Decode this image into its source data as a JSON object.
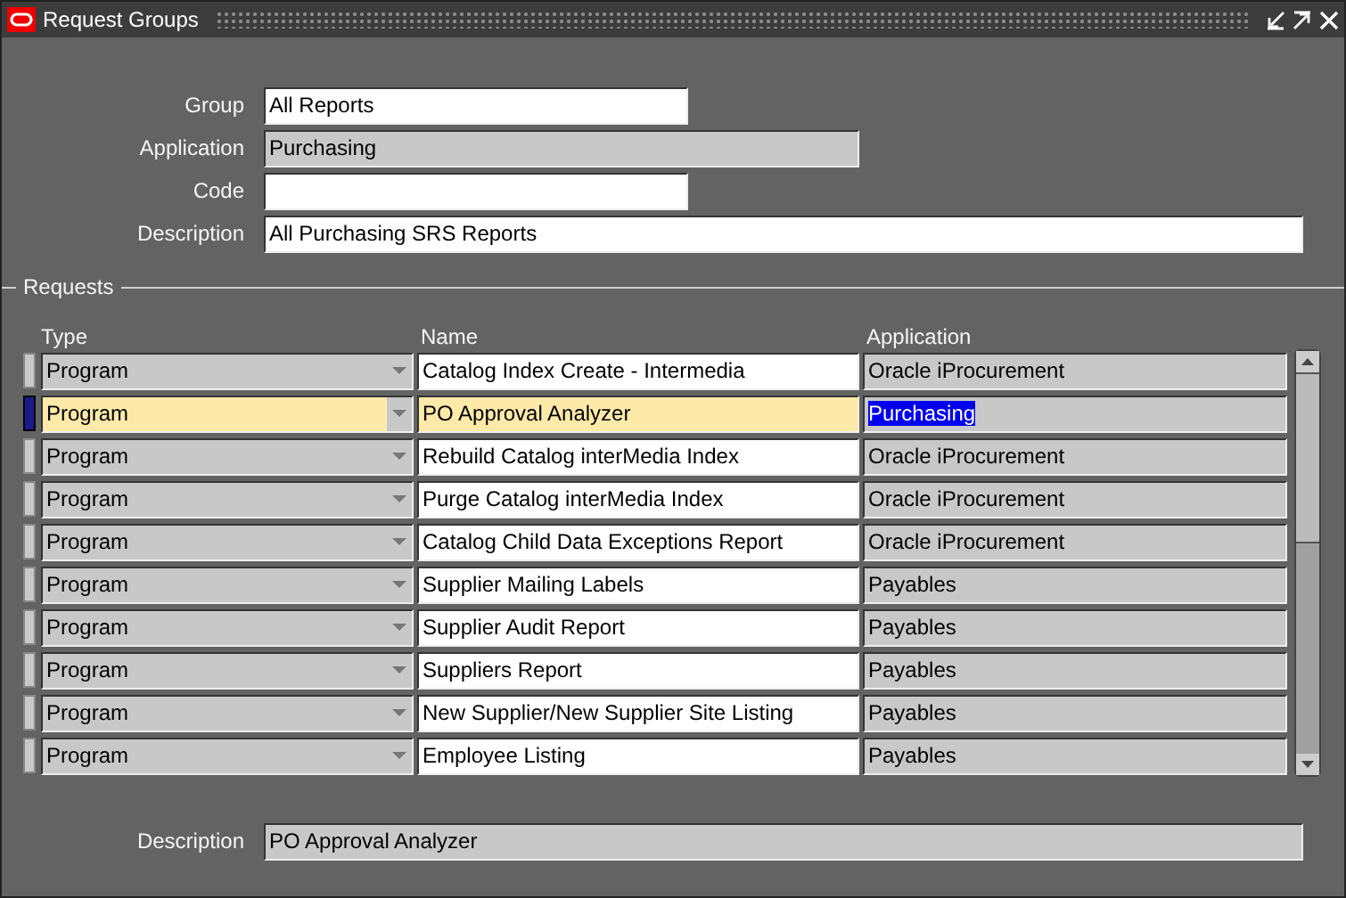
{
  "window": {
    "title": "Request Groups"
  },
  "header_fields": [
    {
      "label": "Group",
      "value": "All Reports",
      "editable": true
    },
    {
      "label": "Application",
      "value": "Purchasing",
      "editable": false
    },
    {
      "label": "Code",
      "editable": true
    },
    {
      "label": "Description",
      "value": "All Purchasing SRS Reports",
      "editable": true
    }
  ],
  "requests": {
    "title": "Requests",
    "columns": [
      "Type",
      "Name",
      "Application"
    ],
    "rows": [
      {
        "type": "Program",
        "name": "Catalog Index Create - Intermedia",
        "application": "Oracle iProcurement",
        "selected": false
      },
      {
        "type": "Program",
        "name": "PO Approval Analyzer",
        "application": "Purchasing",
        "selected": true
      },
      {
        "type": "Program",
        "name": "Rebuild Catalog interMedia Index",
        "application": "Oracle iProcurement",
        "selected": false
      },
      {
        "type": "Program",
        "name": "Purge Catalog interMedia Index",
        "application": "Oracle iProcurement",
        "selected": false
      },
      {
        "type": "Program",
        "name": "Catalog Child Data Exceptions Report",
        "application": "Oracle iProcurement",
        "selected": false
      },
      {
        "type": "Program",
        "name": "Supplier Mailing Labels",
        "application": "Payables",
        "selected": false
      },
      {
        "type": "Program",
        "name": "Supplier Audit Report",
        "application": "Payables",
        "selected": false
      },
      {
        "type": "Program",
        "name": "Suppliers Report",
        "application": "Payables",
        "selected": false
      },
      {
        "type": "Program",
        "name": "New Supplier/New Supplier Site Listing",
        "application": "Payables",
        "selected": false
      },
      {
        "type": "Program",
        "name": "Employee Listing",
        "application": "Payables",
        "selected": false
      }
    ]
  },
  "footer": {
    "label": "Description",
    "value": "PO Approval Analyzer"
  }
}
